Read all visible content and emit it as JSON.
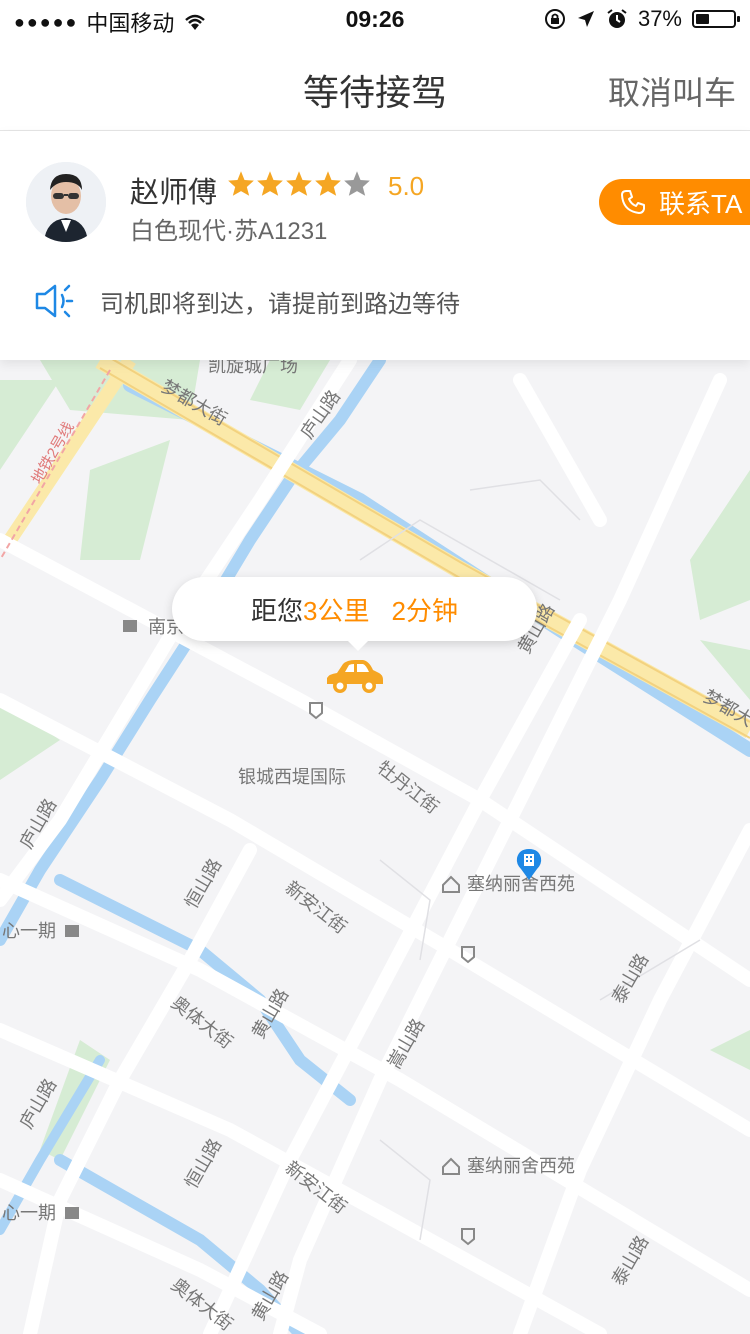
{
  "status_bar": {
    "signal": "●●●●●",
    "carrier": "中国移动",
    "time": "09:26",
    "battery": "37%",
    "battery_level": 0.37
  },
  "header": {
    "title": "等待接驾",
    "cancel_label": "取消叫车"
  },
  "driver": {
    "name": "赵师傅",
    "rating": "5.0",
    "stars_filled": 4,
    "car": "白色现代·苏A1231",
    "contact_label": "联系TA"
  },
  "notice": {
    "text": "司机即将到达，请提前到路边等待"
  },
  "eta": {
    "prefix": "距您",
    "distance": "3公里",
    "time": "2分钟"
  },
  "map_labels": {
    "mall": "凯旋城广场",
    "mengdu_st": "梦都大街",
    "mengdu_st_2": "梦都大",
    "lushan_rd": "庐山路",
    "metro": "地铁2号线",
    "nanjing": "南京",
    "huangshan_rd": "黄山路",
    "yincheng": "银城西堤国际",
    "mudanjiang_st": "牡丹江街",
    "hengshan_rd": "恒山路",
    "xinanjiang_st": "新安江街",
    "sena": "塞纳丽舍西苑",
    "taishan_rd": "泰山路",
    "songshan_rd": "嵩山路",
    "aoti_st": "奥体大街",
    "xinyiqi": "心一期"
  },
  "colors": {
    "accent": "#ff8c00",
    "star": "#f5a623",
    "star_empty": "#999999",
    "speaker": "#1e88e5",
    "map_bg": "#f4f4f6",
    "water": "#aad3f5",
    "green": "#d6ecd4"
  }
}
